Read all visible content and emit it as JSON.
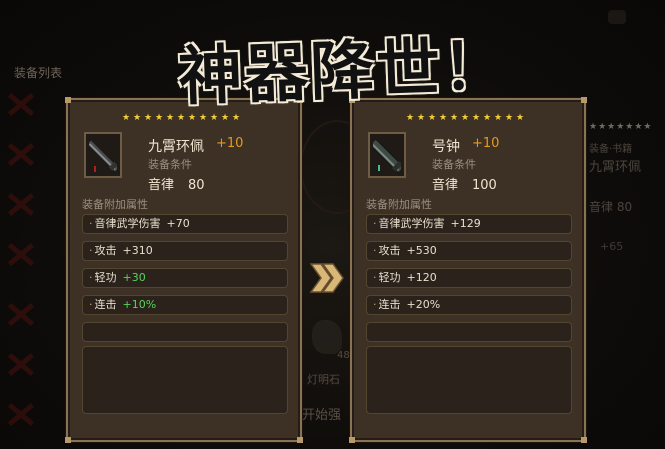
{
  "background": {
    "list_title": "装备列表",
    "right_panel_condition": "装备·书籍",
    "right_panel_name": "九霄环佩",
    "right_panel_rhythm": "音律 80",
    "right_panel_bonus": "+65",
    "stone_count": "48",
    "stone_label": "灯明石",
    "start_button": "开始强"
  },
  "title": "神器降世！",
  "left_panel": {
    "stars": 11,
    "name": "九霄环佩",
    "level": "+10",
    "condition_label": "装备条件",
    "rhythm_label": "音律",
    "rhythm_value": "80",
    "attr_title": "装备附加属性",
    "attrs": [
      {
        "name": "音律武学伤害",
        "bonus": "+70",
        "color": "#e8dfcb"
      },
      {
        "name": "攻击",
        "bonus": "+310",
        "color": "#e8dfcb"
      },
      {
        "name": "轻功",
        "bonus": "+30",
        "color": "#5bd35b"
      },
      {
        "name": "连击",
        "bonus": "+10%",
        "color": "#5bd35b"
      }
    ]
  },
  "right_panel": {
    "stars": 11,
    "name": "号钟",
    "level": "+10",
    "condition_label": "装备条件",
    "rhythm_label": "音律",
    "rhythm_value": "100",
    "attr_title": "装备附加属性",
    "attrs": [
      {
        "name": "音律武学伤害",
        "bonus": "+129",
        "color": "#e8dfcb"
      },
      {
        "name": "攻击",
        "bonus": "+530",
        "color": "#e8dfcb"
      },
      {
        "name": "轻功",
        "bonus": "+120",
        "color": "#e8dfcb"
      },
      {
        "name": "连击",
        "bonus": "+20%",
        "color": "#e8dfcb"
      }
    ]
  },
  "colors": {
    "star": "#f2cf3a",
    "level": "#e59a1e",
    "bonus_green": "#5bd35b"
  },
  "icons": {
    "weapon_left": "qin-weapon-icon",
    "weapon_right": "qin-weapon-icon",
    "arrow": "double-chevron-right-icon"
  }
}
